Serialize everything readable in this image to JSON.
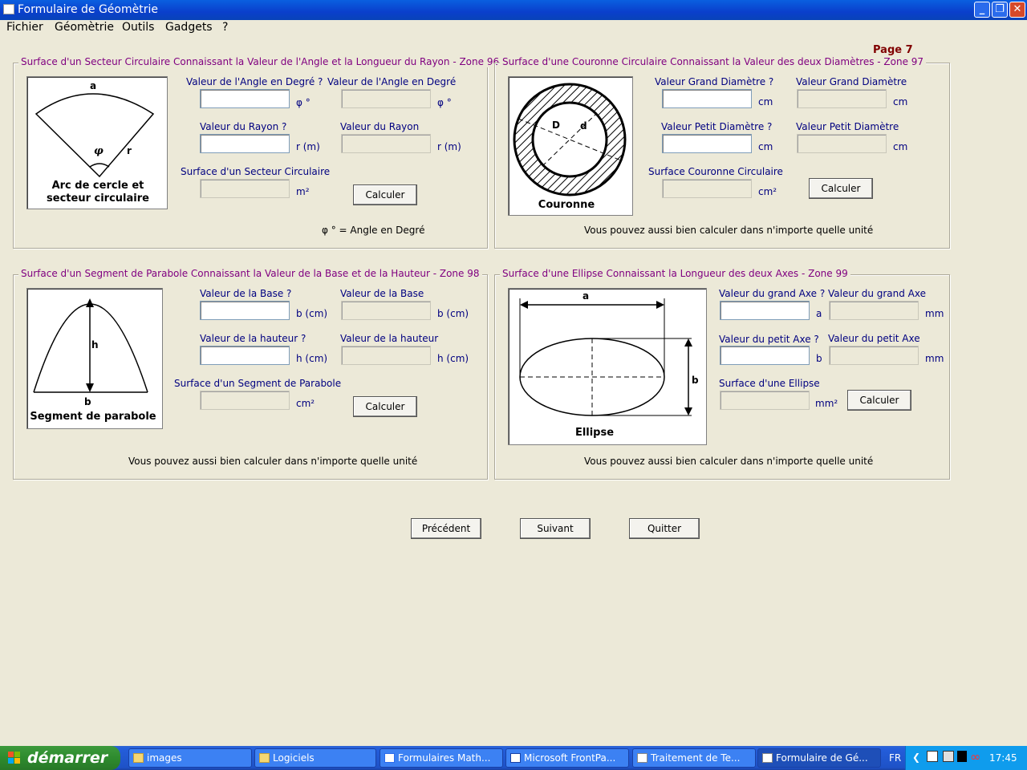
{
  "window": {
    "title": "Formulaire de Géomètrie"
  },
  "menu": [
    "Fichier",
    "Géomètrie",
    "Outils",
    "Gadgets",
    "?"
  ],
  "page_label": "Page 7",
  "zone96": {
    "legend": "Surface d'un Secteur Circulaire Connaissant la Valeur de l'Angle et la Longueur du Rayon - Zone 96",
    "angle_in_label": "Valeur de l'Angle en Degré ?",
    "angle_out_label": "Valeur de l'Angle en Degré",
    "angle_unit": "φ °",
    "radius_in_label": "Valeur du Rayon ?",
    "radius_out_label": "Valeur du Rayon",
    "radius_unit": "r  (m)",
    "result_label": "Surface d'un Secteur Circulaire",
    "result_unit": "m²",
    "button": "Calculer",
    "note": "φ °  = Angle en Degré",
    "fig_a": "a",
    "fig_phi": "φ",
    "fig_r": "r",
    "fig_caption1": "Arc de cercle et",
    "fig_caption2": "secteur circulaire"
  },
  "zone97": {
    "legend": "Surface d'une Couronne Circulaire Connaissant la Valeur des deux Diamètres - Zone 97",
    "big_in_label": "Valeur Grand Diamètre ?",
    "big_out_label": "Valeur Grand Diamètre",
    "small_in_label": "Valeur Petit Diamètre ?",
    "small_out_label": "Valeur Petit Diamètre",
    "unit": "cm",
    "result_label": "Surface Couronne Circulaire",
    "result_unit": "cm²",
    "button": "Calculer",
    "note": "Vous pouvez aussi bien calculer dans n'importe quelle unité",
    "fig_D": "D",
    "fig_d": "d",
    "fig_caption": "Couronne"
  },
  "zone98": {
    "legend": "Surface d'un Segment de Parabole Connaissant la Valeur de la Base et de la Hauteur - Zone 98",
    "base_in_label": "Valeur de la Base ?",
    "base_out_label": "Valeur de la Base",
    "base_unit": "b  (cm)",
    "height_in_label": "Valeur de la hauteur ?",
    "height_out_label": "Valeur de la hauteur",
    "height_unit": "h  (cm)",
    "result_label": "Surface d'un Segment de Parabole",
    "result_unit": "cm²",
    "button": "Calculer",
    "note": "Vous pouvez aussi bien calculer dans n'importe quelle unité",
    "fig_h": "h",
    "fig_b": "b",
    "fig_caption": "Segment de parabole"
  },
  "zone99": {
    "legend": "Surface d'une Ellipse Connaissant la Longueur des deux Axes - Zone 99",
    "a_in_label": "Valeur du grand Axe ?",
    "a_out_label": "Valeur du grand Axe",
    "a_unit": "a",
    "b_in_label": "Valeur du petit Axe ?",
    "b_out_label": "Valeur du petit Axe",
    "b_unit": "b",
    "out_unit": "mm",
    "result_label": "Surface d'une Ellipse",
    "result_unit": "mm²",
    "button": "Calculer",
    "note": "Vous pouvez aussi bien calculer dans n'importe quelle unité",
    "fig_a": "a",
    "fig_b": "b",
    "fig_caption": "Ellipse"
  },
  "nav": {
    "prev": "Précédent",
    "next": "Suivant",
    "quit": "Quitter"
  },
  "taskbar": {
    "start": "démarrer",
    "tasks": [
      "images",
      "Logiciels",
      "Formulaires Math...",
      "Microsoft FrontPa...",
      "Traitement de Te...",
      "Formulaire de Gé..."
    ],
    "lang": "FR",
    "clock": "17:45"
  },
  "colors": {
    "legend": "#800080",
    "label": "#000080",
    "page": "#800000",
    "taskbar": "#245edb",
    "start": "#2e8b2e"
  }
}
